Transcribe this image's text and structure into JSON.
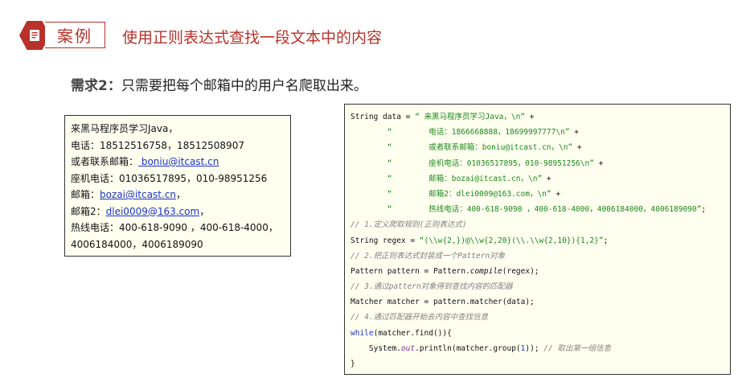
{
  "header": {
    "badge_label": "案例",
    "title": "使用正则表达式查找一段文本中的内容"
  },
  "requirement": {
    "label": "需求2：",
    "text": "只需要把每个邮箱中的用户名爬取出来。"
  },
  "sample_text": {
    "line1": "来黑马程序员学习Java，",
    "line2": "电话：18512516758，18512508907",
    "line3_prefix": "或者联系邮箱：",
    "line3_link": " boniu@itcast.cn",
    "line4": "座机电话：01036517895，010-98951256",
    "line5_prefix": "邮箱：",
    "line5_link": "bozai@itcast.cn",
    "line5_suffix": "，",
    "line6_prefix": "邮箱2：",
    "line6_link": "dlei0009@163.com",
    "line6_suffix": "，",
    "line7": "热线电话：400-618-9090 ，400-618-4000，",
    "line8": "4006184000，4006189090"
  },
  "code": {
    "l1_a": "String data = ",
    "l1_b": "“ 来黑马程序员学习Java，\\n”",
    "l1_c": " +",
    "l2_b": "        “        电话：1866668888，18699997777\\n”",
    "l2_c": " +",
    "l3_b": "        “        或者联系邮箱：boniu@itcast.cn，\\n”",
    "l3_c": " +",
    "l4_b": "        “        座机电话：01036517895，010-98951256\\n”",
    "l4_c": " +",
    "l5_b": "        “        邮箱：bozai@itcast.cn，\\n”",
    "l5_c": " +",
    "l6_b": "        “        邮箱2：dlei0009@163.com，\\n”",
    "l6_c": " +",
    "l7_b": "        “        热线电话：400-618-9090 ，400-618-4000，4006184000，4006189090”",
    "l7_c": ";",
    "c1": "// 1.定义爬取规则(正则表达式)",
    "l8_a": "String regex = ",
    "l8_b": "“(\\\\w{2,})@\\\\w{2,20}(\\\\.\\\\w{2,10}){1,2}”",
    "l8_c": ";",
    "c2": "// 2.把正则表达式封装成一个Pattern对象",
    "l9_a": "Pattern pattern = Pattern.",
    "l9_b": "compile",
    "l9_c": "(regex);",
    "c3": "// 3.通过pattern对象得到查找内容的匹配器",
    "l10": "Matcher matcher = pattern.matcher(data);",
    "c4": "// 4.通过匹配器开始去内容中查找信息",
    "l11_kw": "while",
    "l11_rest": "(matcher.find()){",
    "l12_a": "    System.",
    "l12_out": "out",
    "l12_b": ".println(matcher.group(",
    "l12_num": "1",
    "l12_c": ")); ",
    "l12_cmt": "// 取出第一组信息",
    "l13": "}"
  }
}
